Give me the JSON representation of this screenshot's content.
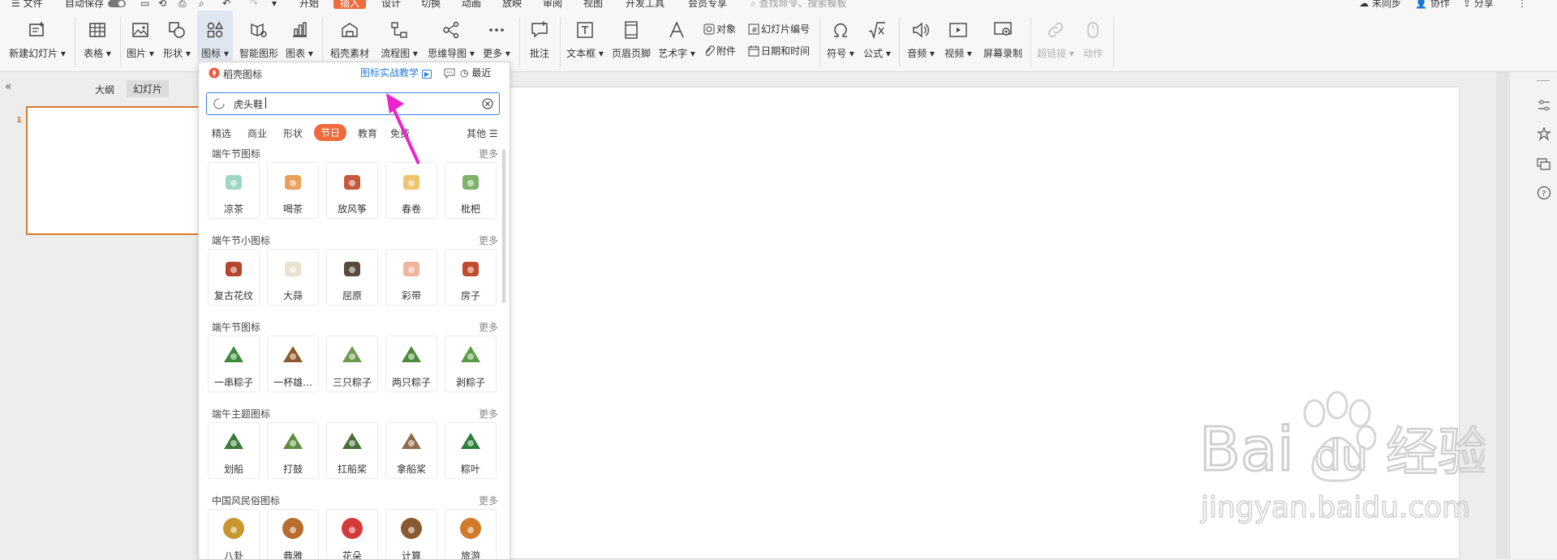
{
  "menubar": {
    "file": "文件",
    "autosave": "自动保存",
    "tabs": [
      "开始",
      "插入",
      "设计",
      "切换",
      "动画",
      "放映",
      "审阅",
      "视图",
      "开发工具",
      "会员专享"
    ],
    "search_placeholder": "查找命令、搜索模板",
    "unsync": "未同步",
    "collab": "协作",
    "share": "分享"
  },
  "ribbon": {
    "new_slide": "新建幻灯片",
    "table": "表格",
    "picture": "图片",
    "shape": "形状",
    "icon": "图标",
    "smartart": "智能图形",
    "chart": "图表",
    "material": "稻壳素材",
    "flowchart": "流程图",
    "mindmap": "思维导图",
    "more": "更多",
    "comment": "批注",
    "textbox": "文本框",
    "header_footer": "页眉页脚",
    "wordart": "艺术字",
    "object": "对象",
    "attachment": "附件",
    "slide_number": "幻灯片编号",
    "datetime": "日期和时间",
    "symbol": "符号",
    "formula": "公式",
    "audio": "音频",
    "video": "视频",
    "screen_record": "屏幕录制",
    "hyperlink": "超链接",
    "action": "动作"
  },
  "leftpanel": {
    "outline_tab": "大纲",
    "slides_tab": "幻灯片",
    "slide_number": "1"
  },
  "popup": {
    "title": "稻壳图标",
    "tutorial_link": "图标实战教学",
    "recent": "最近",
    "search_value": "虎头鞋",
    "categories": [
      "精选",
      "商业",
      "形状",
      "节日",
      "教育",
      "免费"
    ],
    "other": "其他",
    "more": "更多",
    "sections": [
      {
        "title": "端午节图标",
        "items": [
          "凉茶",
          "喝茶",
          "放风筝",
          "春卷",
          "枇杷"
        ]
      },
      {
        "title": "端午节小图标",
        "items": [
          "复古花纹",
          "大蒜",
          "屈原",
          "彩带",
          "房子"
        ]
      },
      {
        "title": "端午节图标",
        "items": [
          "一串粽子",
          "一杯雄...",
          "三只粽子",
          "两只粽子",
          "剥粽子"
        ]
      },
      {
        "title": "端午主题图标",
        "items": [
          "划船",
          "打鼓",
          "扛船桨",
          "拿船桨",
          "粽叶"
        ]
      },
      {
        "title": "中国风民俗图标",
        "items": [
          "八卦",
          "典雅",
          "花朵",
          "计算",
          "旅游"
        ]
      }
    ]
  },
  "watermark": {
    "brand": "Bai",
    "brand2": "du",
    "cn": "经验",
    "url": "jingyan.baidu.com"
  },
  "colors": {
    "accent": "#ef6a3c",
    "link_blue": "#2a7ad8",
    "arrow": "#ee22cc",
    "slide_border": "#d97a2c"
  }
}
